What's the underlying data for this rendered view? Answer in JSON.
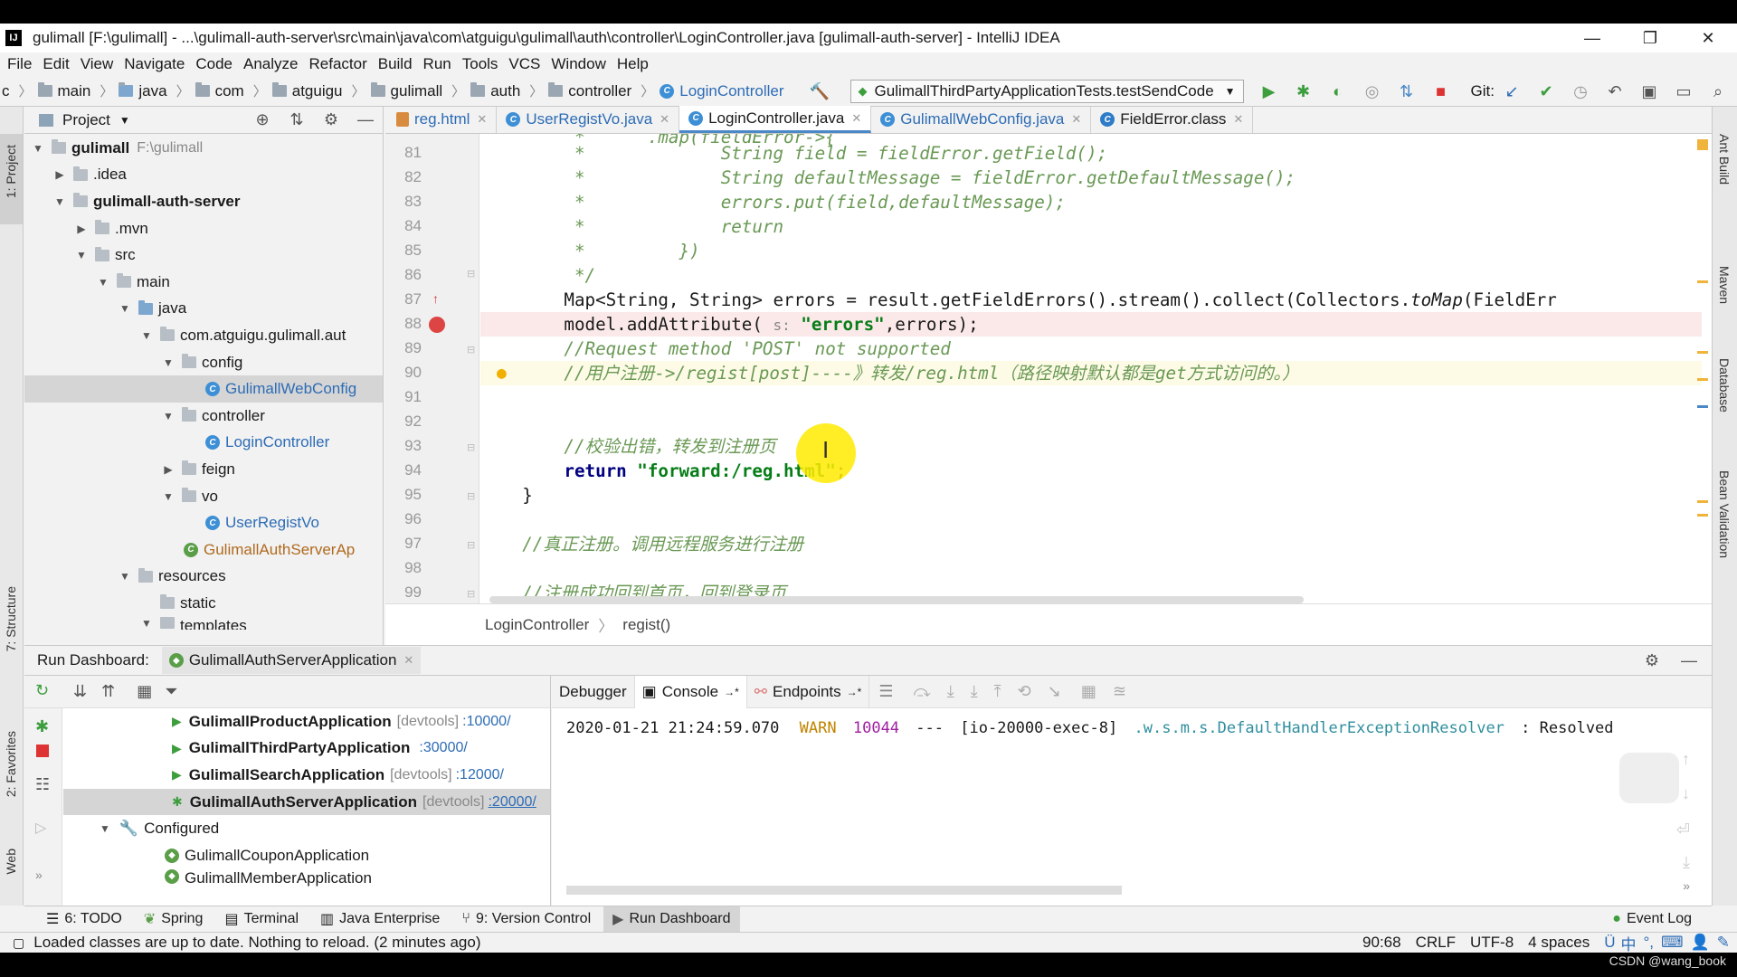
{
  "window": {
    "title": "gulimall [F:\\gulimall] - ...\\gulimall-auth-server\\src\\main\\java\\com\\atguigu\\gulimall\\auth\\controller\\LoginController.java [gulimall-auth-server] - IntelliJ IDEA",
    "logo": "IJ"
  },
  "menu": [
    "File",
    "Edit",
    "View",
    "Navigate",
    "Code",
    "Analyze",
    "Refactor",
    "Build",
    "Run",
    "Tools",
    "VCS",
    "Window",
    "Help"
  ],
  "navbar": {
    "crumbs": [
      "c",
      "main",
      "java",
      "com",
      "atguigu",
      "gulimall",
      "auth",
      "controller"
    ],
    "current_class": "LoginController",
    "run_config": "GulimallThirdPartyApplicationTests.testSendCode",
    "git_label": "Git:"
  },
  "left_strip": {
    "project": "1: Project",
    "structure": "7: Structure",
    "favorites": "2: Favorites",
    "web": "Web"
  },
  "right_strip": {
    "ant": "Ant Build",
    "maven": "Maven",
    "database": "Database",
    "bean": "Bean Validation"
  },
  "project": {
    "title": "Project",
    "tree": [
      {
        "label": "gulimall",
        "extra": "F:\\gulimall",
        "depth": 0,
        "arrow": "▼",
        "bold": true
      },
      {
        "label": ".idea",
        "depth": 1,
        "arrow": "▶"
      },
      {
        "label": "gulimall-auth-server",
        "depth": 1,
        "arrow": "▼",
        "bold": true
      },
      {
        "label": ".mvn",
        "depth": 2,
        "arrow": "▶"
      },
      {
        "label": "src",
        "depth": 2,
        "arrow": "▼"
      },
      {
        "label": "main",
        "depth": 3,
        "arrow": "▼"
      },
      {
        "label": "java",
        "depth": 4,
        "arrow": "▼",
        "blue": true
      },
      {
        "label": "com.atguigu.gulimall.aut",
        "depth": 5,
        "arrow": "▼"
      },
      {
        "label": "config",
        "depth": 6,
        "arrow": "▼"
      },
      {
        "label": "GulimallWebConfig",
        "depth": 7,
        "cls": true,
        "selected": true
      },
      {
        "label": "controller",
        "depth": 6,
        "arrow": "▼"
      },
      {
        "label": "LoginController",
        "depth": 7,
        "cls": true
      },
      {
        "label": "feign",
        "depth": 6,
        "arrow": "▶"
      },
      {
        "label": "vo",
        "depth": 6,
        "arrow": "▼"
      },
      {
        "label": "UserRegistVo",
        "depth": 7,
        "cls": true
      },
      {
        "label": "GulimallAuthServerAp",
        "depth": 6,
        "cls": true,
        "orange": true
      },
      {
        "label": "resources",
        "depth": 4,
        "arrow": "▼"
      },
      {
        "label": "static",
        "depth": 5
      },
      {
        "label": "templates",
        "depth": 5,
        "arrow": "▼"
      }
    ]
  },
  "tabs": [
    {
      "label": "reg.html",
      "type": "html"
    },
    {
      "label": "UserRegistVo.java",
      "type": "class"
    },
    {
      "label": "LoginController.java",
      "type": "class",
      "active": true
    },
    {
      "label": "GulimallWebConfig.java",
      "type": "class"
    },
    {
      "label": "FieldError.class",
      "type": "class"
    }
  ],
  "editor": {
    "line_numbers": [
      "81",
      "82",
      "83",
      "84",
      "85",
      "86",
      "87",
      "88",
      "89",
      "90",
      "91",
      "92",
      "93",
      "94",
      "95",
      "96",
      "97",
      "98",
      "99"
    ],
    "code": {
      "l80": "         *      .map(fieldError->{",
      "l81_a": "         *             ",
      "l81_b": "String field = fieldError.getField();",
      "l82_a": "         *             ",
      "l82_b": "String defaultMessage = fieldError.getDefaultMessage();",
      "l83_a": "         *             ",
      "l83_b": "errors.put(field,defaultMessage);",
      "l84_a": "         *             ",
      "l84_b": "return",
      "l85": "         *         })",
      "l86": "         */",
      "l87_a": "        Map<String, String> errors = result.getFieldErrors().stream().collect(Collectors.",
      "l87_b": "toMap",
      "l87_c": "(FieldErr",
      "l88_a": "        model.addAttribute( ",
      "l88_hint": "s:",
      "l88_str": " \"errors\"",
      "l88_b": ",errors);",
      "l89": "        //Request method 'POST' not supported",
      "l90": "        //用户注册->/regist[post]----》转发/reg.html（路径映射默认都是get方式访问的。）",
      "l93": "        //校验出错，转发到注册页",
      "l94_kw": "        return",
      "l94_str": " \"forward:/reg.html\"",
      "l94_b": ";",
      "l95": "    }",
      "l97": "    //真正注册。调用远程服务进行注册",
      "l99": "    //注册成功回到首页，回到登录页"
    },
    "breadcrumb": [
      "LoginController",
      "regist()"
    ]
  },
  "run_dashboard": {
    "label": "Run Dashboard:",
    "app_tab": "GulimallAuthServerApplication",
    "services": [
      {
        "name": "GulimallProductApplication",
        "dev": "[devtools]",
        "port": ":10000/"
      },
      {
        "name": "GulimallThirdPartyApplication",
        "dev": "",
        "port": ":30000/"
      },
      {
        "name": "GulimallSearchApplication",
        "dev": "[devtools]",
        "port": ":12000/"
      },
      {
        "name": "GulimallAuthServerApplication",
        "dev": "[devtools]",
        "port": ":20000/",
        "selected": true
      }
    ],
    "configured_label": "Configured",
    "configured": [
      "GulimallCouponApplication",
      "GulimallMemberApplication"
    ],
    "console_tabs": [
      "Debugger",
      "Console",
      "Endpoints"
    ],
    "console_line": {
      "time": "2020-01-21 21:24:59.070",
      "level": "WARN",
      "pid": "10044",
      "sep": "---",
      "thread": "[io-20000-exec-8]",
      "logger": ".w.s.m.s.DefaultHandlerExceptionResolver",
      "msg": ": Resolved"
    }
  },
  "tool_tabs": [
    {
      "label": "6: TODO"
    },
    {
      "label": "Spring"
    },
    {
      "label": "Terminal"
    },
    {
      "label": "Java Enterprise"
    },
    {
      "label": "9: Version Control"
    },
    {
      "label": "Run Dashboard",
      "active": true
    }
  ],
  "event_log": "Event Log",
  "status": {
    "message": "Loaded classes are up to date. Nothing to reload. (2 minutes ago)",
    "position": "90:68",
    "line_sep": "CRLF",
    "encoding": "UTF-8",
    "indent": "4 spaces",
    "ime": "中"
  },
  "watermark": "CSDN @wang_book",
  "colors": {
    "accent": "#4a88c7",
    "comment": "#6a9955",
    "keyword": "#000080",
    "string": "#067d17",
    "warn": "#c18400"
  }
}
